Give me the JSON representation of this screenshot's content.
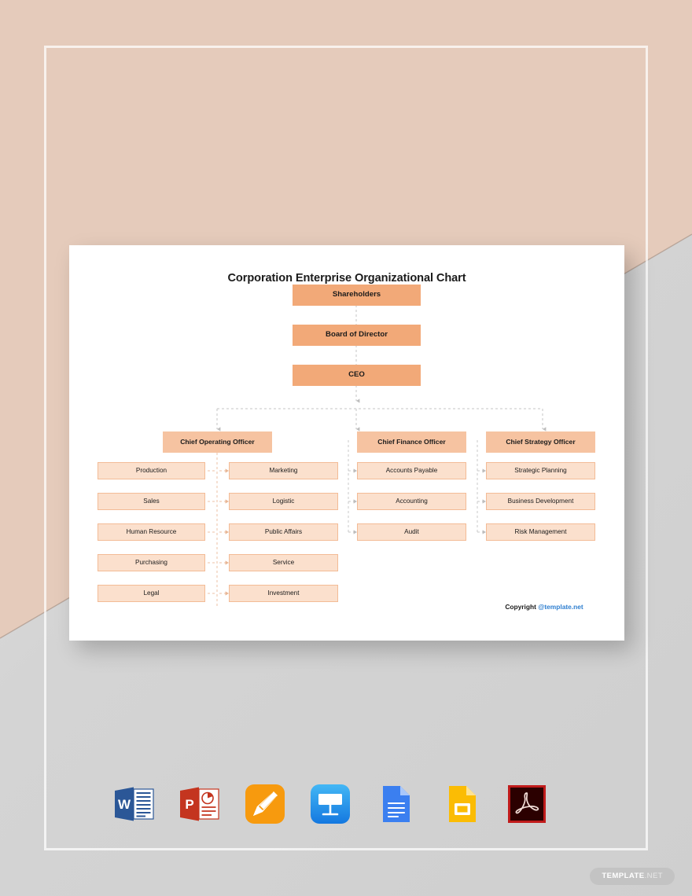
{
  "document": {
    "title": "Corporation Enterprise Organizational Chart",
    "copyright_label": "Copyright",
    "copyright_link": "@template.net"
  },
  "watermark": {
    "strong": "TEMPLATE",
    "light": ".NET"
  },
  "colors": {
    "page_peach": "#e5cbbb",
    "page_gray": "#d4d4d4",
    "card": "#ffffff",
    "node_top": "#f2a978",
    "node_officer": "#f6c3a1",
    "node_dept": "#fbe0cd",
    "node_dept_border": "#f3bb96",
    "connector": "#bfbfbf",
    "connector_dept": "#f0b893",
    "link_blue": "#2f7fd0",
    "watermark_bg": "#c3c3c3"
  },
  "chart_data": {
    "type": "diagram",
    "subtype": "org-chart",
    "title": "Corporation Enterprise Organizational Chart",
    "orientation": "top-down",
    "connector_style": "dashed-with-arrows",
    "levels": [
      {
        "level": 0,
        "nodes": [
          "Shareholders"
        ]
      },
      {
        "level": 1,
        "nodes": [
          "Board of Director"
        ]
      },
      {
        "level": 2,
        "nodes": [
          "CEO"
        ]
      },
      {
        "level": 3,
        "nodes": [
          "Chief Operating Officer",
          "Chief Finance Officer",
          "Chief Strategy Officer"
        ]
      },
      {
        "level": 4,
        "nodes": [
          "Production",
          "Marketing",
          "Sales",
          "Logistic",
          "Human Resource",
          "Public Affairs",
          "Purchasing",
          "Service",
          "Legal",
          "Investment",
          "Accounts Payable",
          "Accounting",
          "Audit",
          "Strategic Planning",
          "Business Development",
          "Risk Management"
        ]
      }
    ],
    "edges": [
      {
        "from": "Shareholders",
        "to": "Board of Director"
      },
      {
        "from": "Board of Director",
        "to": "CEO"
      },
      {
        "from": "CEO",
        "to": "Chief Operating Officer"
      },
      {
        "from": "CEO",
        "to": "Chief Finance Officer"
      },
      {
        "from": "CEO",
        "to": "Chief Strategy Officer"
      },
      {
        "from": "Chief Operating Officer",
        "to": "Production"
      },
      {
        "from": "Chief Operating Officer",
        "to": "Marketing"
      },
      {
        "from": "Chief Operating Officer",
        "to": "Sales"
      },
      {
        "from": "Chief Operating Officer",
        "to": "Logistic"
      },
      {
        "from": "Chief Operating Officer",
        "to": "Human Resource"
      },
      {
        "from": "Chief Operating Officer",
        "to": "Public Affairs"
      },
      {
        "from": "Chief Operating Officer",
        "to": "Purchasing"
      },
      {
        "from": "Chief Operating Officer",
        "to": "Service"
      },
      {
        "from": "Chief Operating Officer",
        "to": "Legal"
      },
      {
        "from": "Chief Operating Officer",
        "to": "Investment"
      },
      {
        "from": "Chief Finance Officer",
        "to": "Accounts Payable"
      },
      {
        "from": "Chief Finance Officer",
        "to": "Accounting"
      },
      {
        "from": "Chief Finance Officer",
        "to": "Audit"
      },
      {
        "from": "Chief Strategy Officer",
        "to": "Strategic Planning"
      },
      {
        "from": "Chief Strategy Officer",
        "to": "Business Development"
      },
      {
        "from": "Chief Strategy Officer",
        "to": "Risk Management"
      }
    ]
  },
  "nodes": {
    "shareholders": "Shareholders",
    "board": "Board of Director",
    "ceo": "CEO",
    "coo": "Chief Operating Officer",
    "cfo": "Chief Finance Officer",
    "cso": "Chief Strategy Officer",
    "production": "Production",
    "sales": "Sales",
    "human_resource": "Human Resource",
    "purchasing": "Purchasing",
    "legal": "Legal",
    "marketing": "Marketing",
    "logistic": "Logistic",
    "public_affairs": "Public Affairs",
    "service": "Service",
    "investment": "Investment",
    "accounts_payable": "Accounts Payable",
    "accounting": "Accounting",
    "audit": "Audit",
    "strategic_planning": "Strategic Planning",
    "business_development": "Business Development",
    "risk_management": "Risk Management"
  },
  "formats": [
    {
      "id": "word-icon",
      "label": "Microsoft Word"
    },
    {
      "id": "powerpoint-icon",
      "label": "Microsoft PowerPoint"
    },
    {
      "id": "pages-icon",
      "label": "Apple Pages"
    },
    {
      "id": "keynote-icon",
      "label": "Apple Keynote"
    },
    {
      "id": "google-docs-icon",
      "label": "Google Docs"
    },
    {
      "id": "google-slides-icon",
      "label": "Google Slides"
    },
    {
      "id": "pdf-icon",
      "label": "PDF"
    }
  ]
}
